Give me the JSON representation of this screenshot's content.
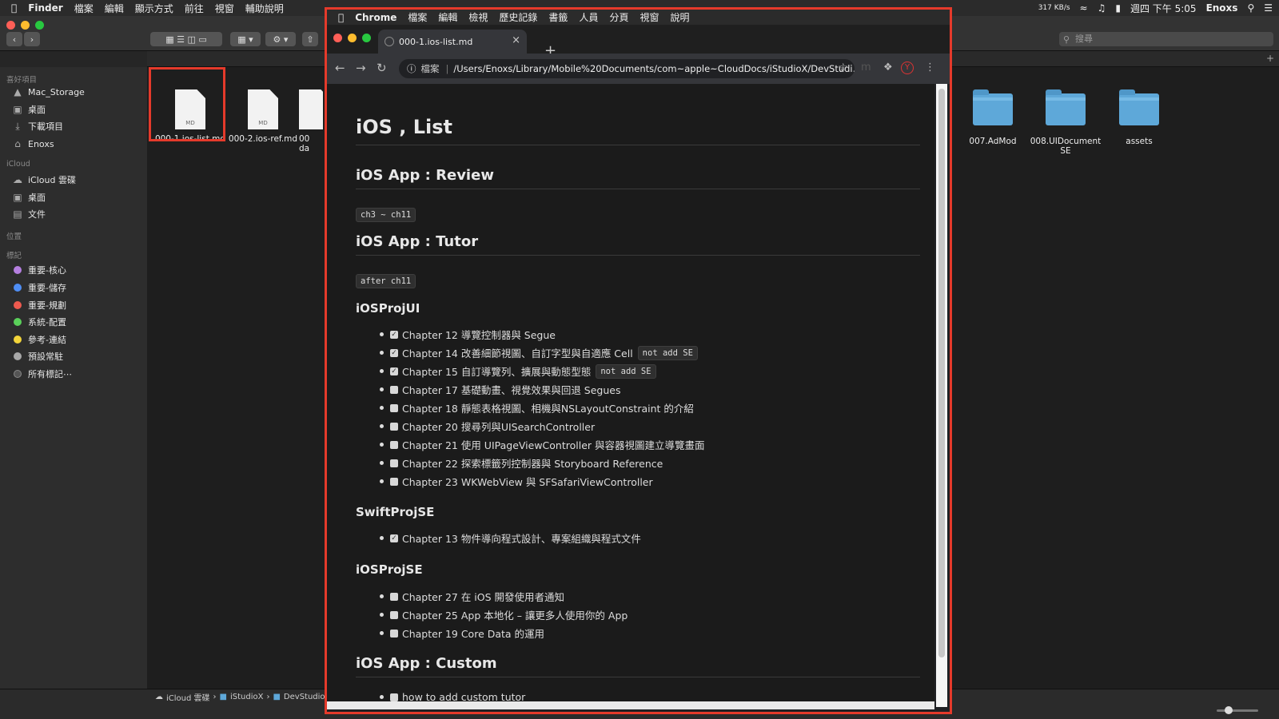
{
  "menubar": {
    "app": "Finder",
    "items": [
      "檔案",
      "編輯",
      "顯示方式",
      "前往",
      "視窗",
      "輔助說明"
    ],
    "net_speed": "317 KB/s",
    "datetime": "週四 下午 5:05",
    "user": "Enoxs"
  },
  "finder": {
    "search_placeholder": "搜尋",
    "sidebar": {
      "favorites_header": "喜好項目",
      "favorites": [
        "Mac_Storage",
        "桌面",
        "下載項目",
        "Enoxs"
      ],
      "icloud_header": "iCloud",
      "icloud": [
        "iCloud 雲碟",
        "桌面",
        "文件"
      ],
      "locations_header": "位置",
      "tags_header": "標記",
      "tags": [
        {
          "label": "重要-核心",
          "color": "#b57fe0"
        },
        {
          "label": "重要-儲存",
          "color": "#4f8ef5"
        },
        {
          "label": "重要-規劃",
          "color": "#ee5a4f"
        },
        {
          "label": "系統-配置",
          "color": "#5ad05a"
        },
        {
          "label": "參考-連結",
          "color": "#f2d43a"
        },
        {
          "label": "預設常駐",
          "color": "#a8a8a8"
        },
        {
          "label": "所有標記⋯",
          "color": "#555555"
        }
      ]
    },
    "files": [
      {
        "name": "000-1.ios-list.md",
        "badge": "MD"
      },
      {
        "name": "000-2.ios-ref.md",
        "badge": "MD"
      },
      {
        "name": "00",
        "badge": ""
      }
    ],
    "file_partial_sub": "da",
    "folders": [
      {
        "name": "007.AdMod"
      },
      {
        "name": "008.UIDocument SE"
      },
      {
        "name": "assets"
      }
    ],
    "breadcrumb": [
      "iCloud 雲碟",
      "iStudioX",
      "DevStudio"
    ]
  },
  "chrome": {
    "menubar": {
      "app": "Chrome",
      "items": [
        "檔案",
        "編輯",
        "檢視",
        "歷史記錄",
        "書籤",
        "人員",
        "分頁",
        "視窗",
        "說明"
      ]
    },
    "tab_title": "000-1.ios-list.md",
    "omnibox": {
      "scheme": "檔案",
      "url": "/Users/Enoxs/Library/Mobile%20Documents/com~apple~CloudDocs/iStudioX/DevStudi..."
    },
    "doc": {
      "h1": "iOS , List",
      "review_h2": "iOS App : Review",
      "review_code": "ch3 ~ ch11",
      "tutor_h2": "iOS App : Tutor",
      "tutor_code": "after ch11",
      "projui_h3": "iOSProjUI",
      "projui_items": [
        {
          "text": "Chapter 12 導覽控制器與 Segue",
          "checked": true,
          "code": ""
        },
        {
          "text": "Chapter 14 改善細節視圖、自訂字型與自適應 Cell",
          "checked": true,
          "code": "not add SE"
        },
        {
          "text": "Chapter 15 自訂導覽列、擴展與動態型態",
          "checked": true,
          "code": "not add SE"
        },
        {
          "text": "Chapter 17 基礎動畫、視覺效果與回退 Segues",
          "checked": false,
          "code": ""
        },
        {
          "text": "Chapter 18 靜態表格視圖、相機與NSLayoutConstraint 的介紹",
          "checked": false,
          "code": ""
        },
        {
          "text": "Chapter 20 搜尋列與UISearchController",
          "checked": false,
          "code": ""
        },
        {
          "text": "Chapter 21 使用 UIPageViewController 與容器視圖建立導覽畫面",
          "checked": false,
          "code": ""
        },
        {
          "text": "Chapter 22 探索標籤列控制器與 Storyboard Reference",
          "checked": false,
          "code": ""
        },
        {
          "text": "Chapter 23 WKWebView 與 SFSafariViewController",
          "checked": false,
          "code": ""
        }
      ],
      "swiftse_h3": "SwiftProjSE",
      "swiftse_items": [
        {
          "text": "Chapter 13 物件導向程式設計、專案組織與程式文件",
          "checked": true,
          "code": ""
        }
      ],
      "projse_h3": "iOSProjSE",
      "projse_items": [
        {
          "text": "Chapter 27 在 iOS 開發使用者通知",
          "checked": false,
          "code": ""
        },
        {
          "text": "Chapter 25 App 本地化 – 讓更多人使用你的 App",
          "checked": false,
          "code": ""
        },
        {
          "text": "Chapter 19 Core Data 的運用",
          "checked": false,
          "code": ""
        }
      ],
      "custom_h2": "iOS App : Custom",
      "custom_items": [
        {
          "text": "how to add custom tutor",
          "checked": false,
          "code": ""
        }
      ]
    }
  }
}
